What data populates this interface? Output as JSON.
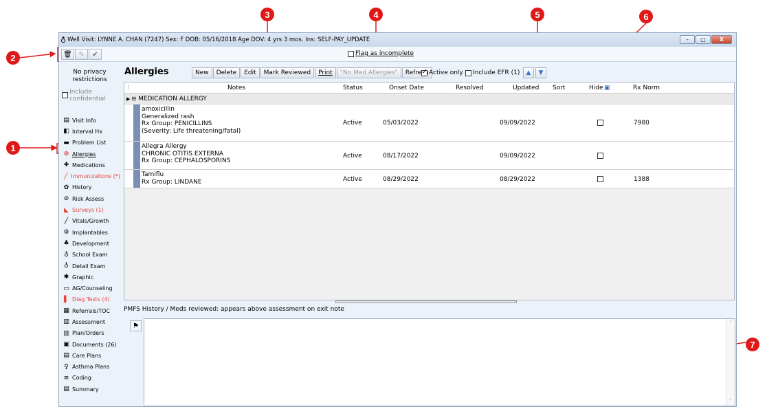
{
  "window": {
    "title": "Well Visit: LYNNE A. CHAN (7247)  Sex: F  DOB: 05/16/2018  Age DOV: 4 yrs 3 mos.  Ins: SELF-PAY_UPDATE",
    "buttons": [
      "–",
      "□",
      "X"
    ]
  },
  "toolbar": {
    "flag_label": "Flag as incomplete"
  },
  "sidebar": {
    "privacy": "No privacy restrictions",
    "include_confidential": "Include confidential",
    "items": [
      {
        "label": "Visit Info",
        "icon": "visit-info-icon",
        "red": false
      },
      {
        "label": "Interval Hx",
        "icon": "interval-hx-icon",
        "red": false
      },
      {
        "label": "Problem List",
        "icon": "problem-list-icon",
        "red": false
      },
      {
        "label": "Allergies",
        "icon": "allergies-icon",
        "red": false,
        "selected": true
      },
      {
        "label": "Medications",
        "icon": "medications-icon",
        "red": false
      },
      {
        "label": "Immunizations (*)",
        "icon": "immunizations-icon",
        "red": true
      },
      {
        "label": "History",
        "icon": "history-icon",
        "red": false
      },
      {
        "label": "Risk Assess",
        "icon": "risk-assess-icon",
        "red": false
      },
      {
        "label": "Surveys (1)",
        "icon": "surveys-icon",
        "red": true
      },
      {
        "label": "Vitals/Growth",
        "icon": "vitals-icon",
        "red": false
      },
      {
        "label": "Implantables",
        "icon": "implantables-icon",
        "red": false
      },
      {
        "label": "Development",
        "icon": "development-icon",
        "red": false
      },
      {
        "label": "School Exam",
        "icon": "stethoscope-icon",
        "red": false
      },
      {
        "label": "Detail Exam",
        "icon": "stethoscope-icon",
        "red": false
      },
      {
        "label": "Graphic",
        "icon": "graphic-icon",
        "red": false
      },
      {
        "label": "AG/Counseling",
        "icon": "counseling-icon",
        "red": false
      },
      {
        "label": "Diag Tests (4)",
        "icon": "diag-tests-icon",
        "red": true
      },
      {
        "label": "Referrals/TOC",
        "icon": "referrals-icon",
        "red": false
      },
      {
        "label": "Assessment",
        "icon": "assessment-icon",
        "red": false
      },
      {
        "label": "Plan/Orders",
        "icon": "plan-orders-icon",
        "red": false
      },
      {
        "label": "Documents (26)",
        "icon": "documents-icon",
        "red": false
      },
      {
        "label": "Care Plans",
        "icon": "care-plans-icon",
        "red": false
      },
      {
        "label": "Asthma Plans",
        "icon": "asthma-plans-icon",
        "red": false
      },
      {
        "label": "Coding",
        "icon": "coding-icon",
        "red": false
      },
      {
        "label": "Summary",
        "icon": "summary-icon",
        "red": false
      }
    ]
  },
  "main": {
    "heading": "Allergies",
    "actions": {
      "new": "New",
      "delete": "Delete",
      "edit": "Edit",
      "mark_reviewed": "Mark Reviewed",
      "print": "Print",
      "no_med_allergies": "\"No Med Allergies\"",
      "refresh": "Refresh"
    },
    "active_only": "Active only",
    "include_efr": "Include EFR (1)",
    "columns": {
      "notes": "Notes",
      "status": "Status",
      "onset": "Onset Date",
      "resolved": "Resolved",
      "updated": "Updated",
      "sort": "Sort",
      "hide": "Hide",
      "rxnorm": "Rx Norm"
    },
    "group": "MEDICATION ALLERGY",
    "rows": [
      {
        "l1": "amoxicillin",
        "l2": "Generalized rash",
        "l3": "Rx Group: PENICILLINS",
        "l4": "(Severity: Life threatening/fatal)",
        "status": "Active",
        "onset": "05/03/2022",
        "resolved": "",
        "updated": "09/09/2022",
        "rxnorm": "7980"
      },
      {
        "l1": "Allegra Allergy",
        "l2": "CHRONIC OTITIS EXTERNA",
        "l3": "Rx Group: CEPHALOSPORINS",
        "l4": "",
        "status": "Active",
        "onset": "08/17/2022",
        "resolved": "",
        "updated": "09/09/2022",
        "rxnorm": ""
      },
      {
        "l1": "Tamiflu",
        "l2": "Rx Group: LINDANE",
        "l3": "",
        "l4": "",
        "status": "Active",
        "onset": "08/29/2022",
        "resolved": "",
        "updated": "08/29/2022",
        "rxnorm": "1388"
      }
    ],
    "pmfs_label": "PMFS History / Meds reviewed: appears above assessment on exit note"
  },
  "callouts": [
    "1",
    "2",
    "3",
    "4",
    "5",
    "6",
    "7"
  ],
  "colors": {
    "callout": "#e01818",
    "selected_row_bar": "#7b8fb5",
    "red_nav": "#e0443a"
  }
}
